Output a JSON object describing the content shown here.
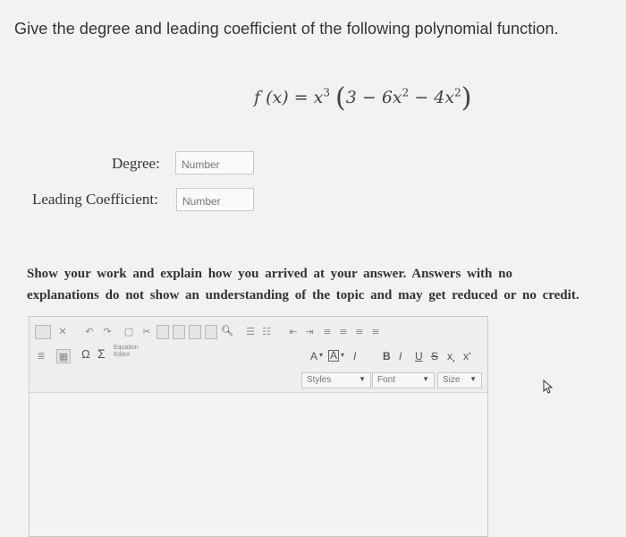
{
  "question": "Give the degree and leading coefficient of the following polynomial function.",
  "formula": {
    "lhs": "f (x) = x",
    "exp3": "3",
    "inner_a": "3 − 6x",
    "exp2a": "2",
    "inner_b": " − 4x",
    "exp2b": "2"
  },
  "degree": {
    "label": "Degree:",
    "placeholder": "Number"
  },
  "leading": {
    "label": "Leading Coefficient:",
    "placeholder": "Number"
  },
  "instructions": {
    "line1": "Show your work and explain how you arrived at your answer. Answers with no",
    "line2": "explanations do not show an understanding of the topic and may get reduced or no credit."
  },
  "editor": {
    "equation_editor": "Equation Editor",
    "omega": "Ω",
    "sigma": "Σ",
    "font_color": "A",
    "bg_color": "A",
    "remove_format": "I",
    "bold": "B",
    "italic": "I",
    "underline": "U",
    "strike": "S",
    "subscript": "x",
    "superscript": "x",
    "styles": "Styles",
    "font": "Font",
    "size": "Size"
  }
}
